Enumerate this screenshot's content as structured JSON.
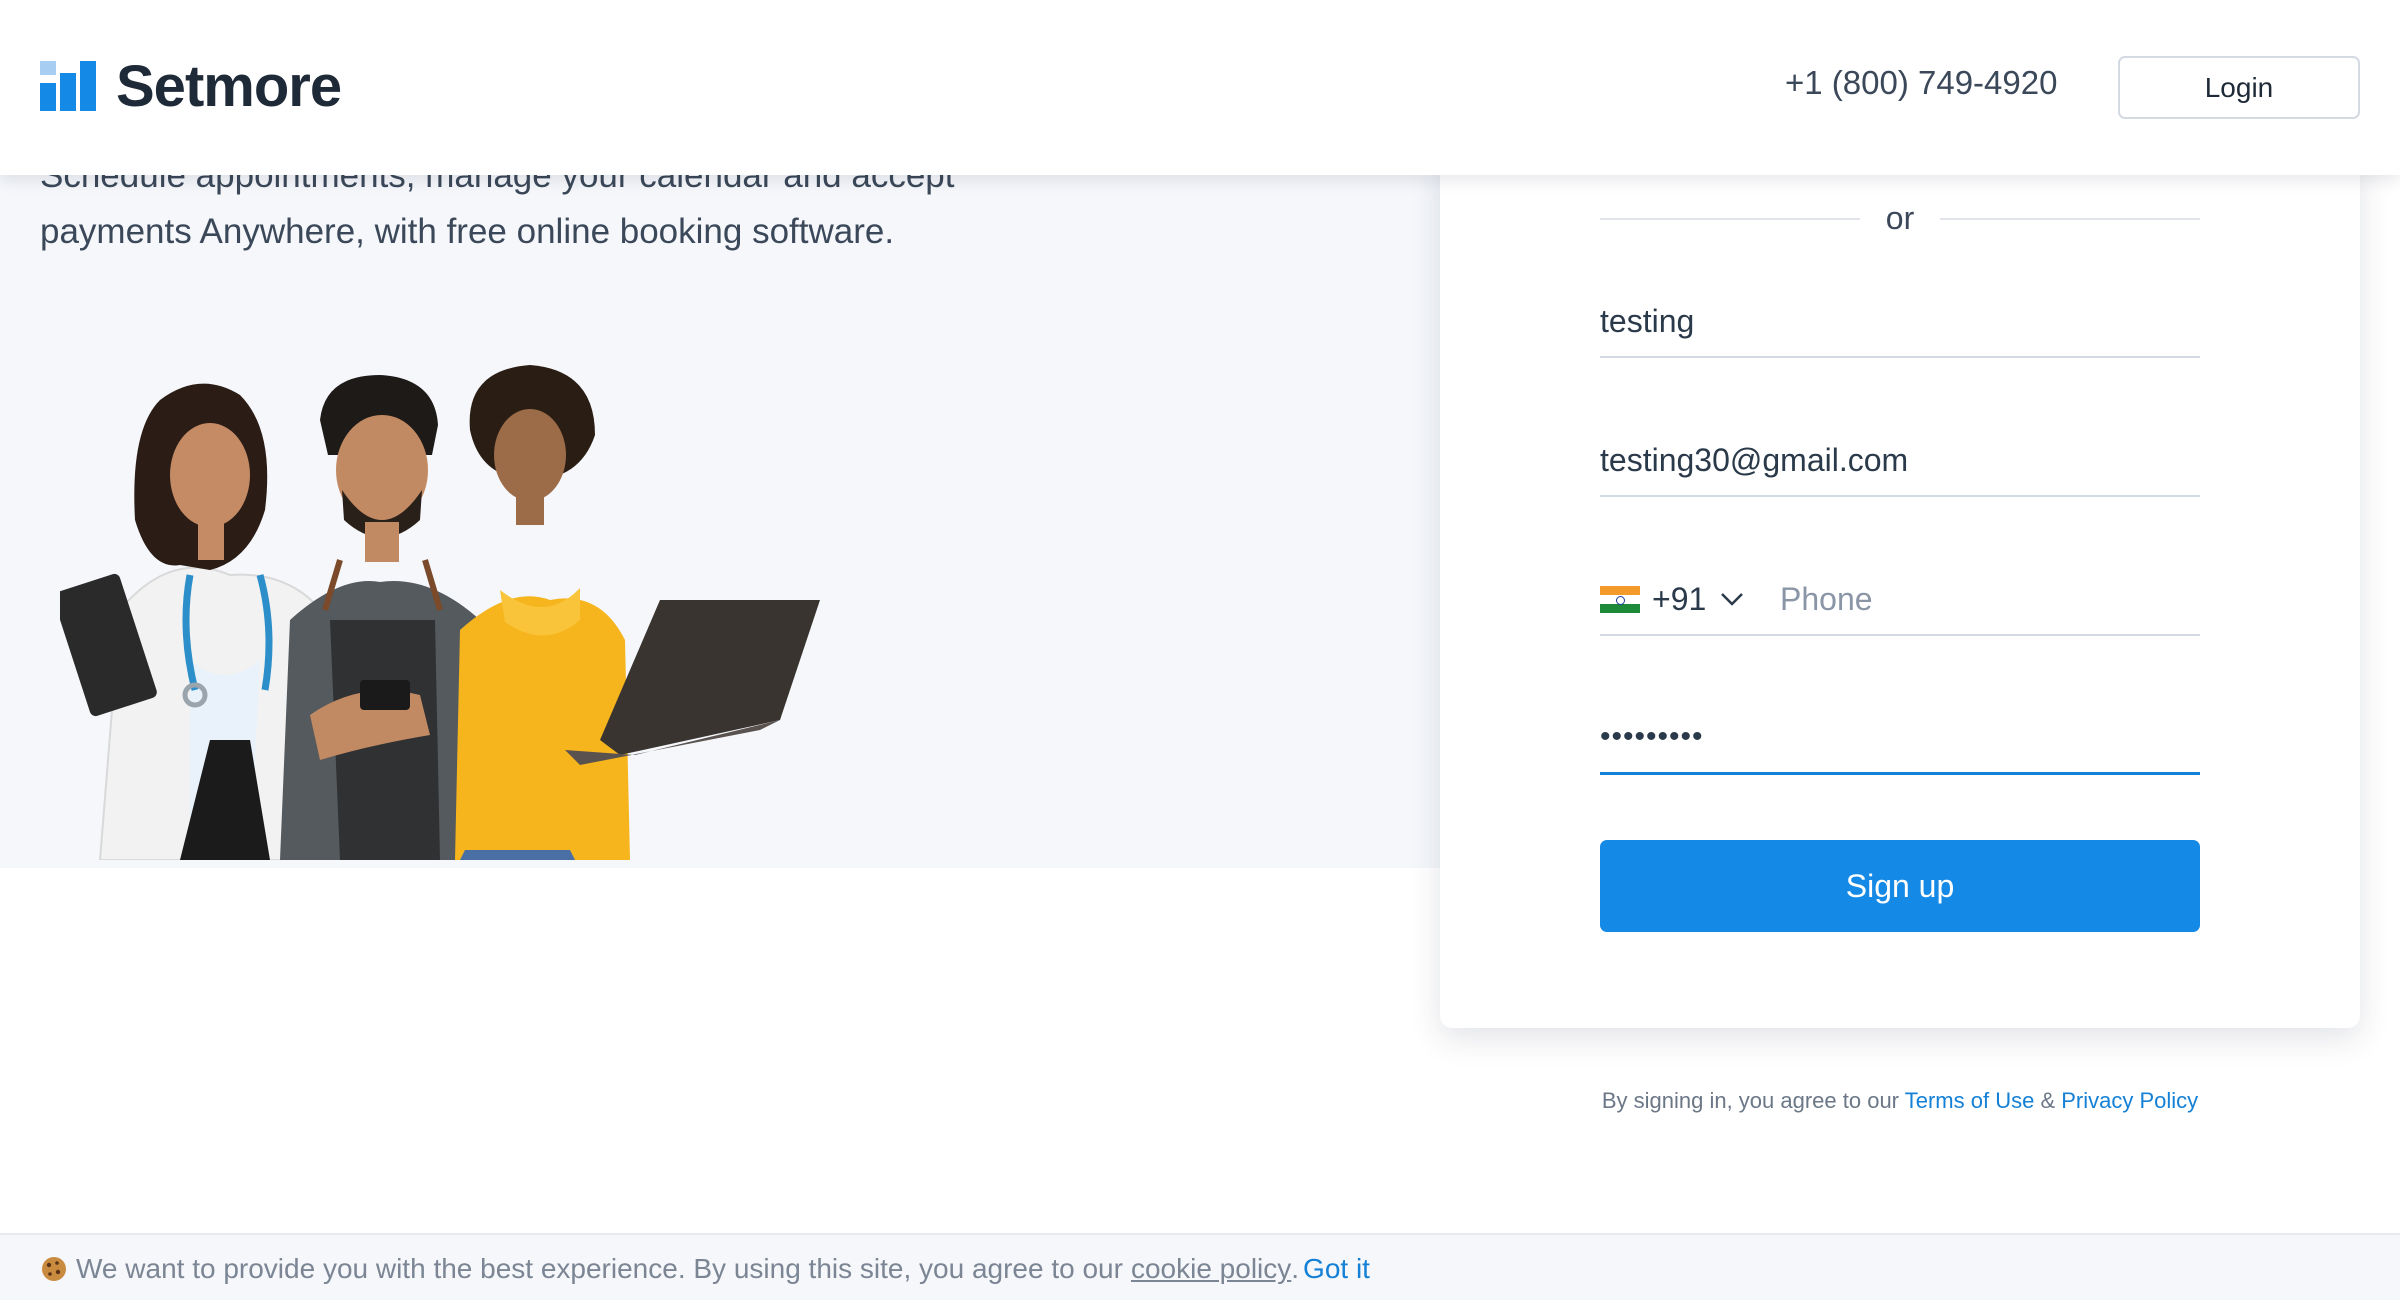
{
  "header": {
    "brand": "Setmore",
    "phone": "+1 (800) 749-4920",
    "login_label": "Login"
  },
  "hero": {
    "subtitle": "Schedule appointments, manage your calendar and accept payments Anywhere, with free online booking software."
  },
  "form": {
    "divider_text": "or",
    "name_value": "testing",
    "email_value": "testing30@gmail.com",
    "country_flag": "india-flag-icon",
    "dial_code": "+91",
    "phone_placeholder": "Phone",
    "password_value": "abcde1234",
    "submit_label": "Sign up"
  },
  "legal": {
    "prefix": "By signing in, you agree to our ",
    "terms_label": "Terms of Use",
    "joiner": " & ",
    "privacy_label": "Privacy Policy"
  },
  "cookie": {
    "message": "We want to provide you with the best experience. By using this site, you agree to our",
    "policy_label": "cookie policy",
    "period": ".",
    "accept_label": "Got it"
  },
  "colors": {
    "accent": "#1589e6",
    "link": "#1480d6",
    "hero_bg": "#f5f7fb",
    "text_dark": "#1f2a38"
  }
}
